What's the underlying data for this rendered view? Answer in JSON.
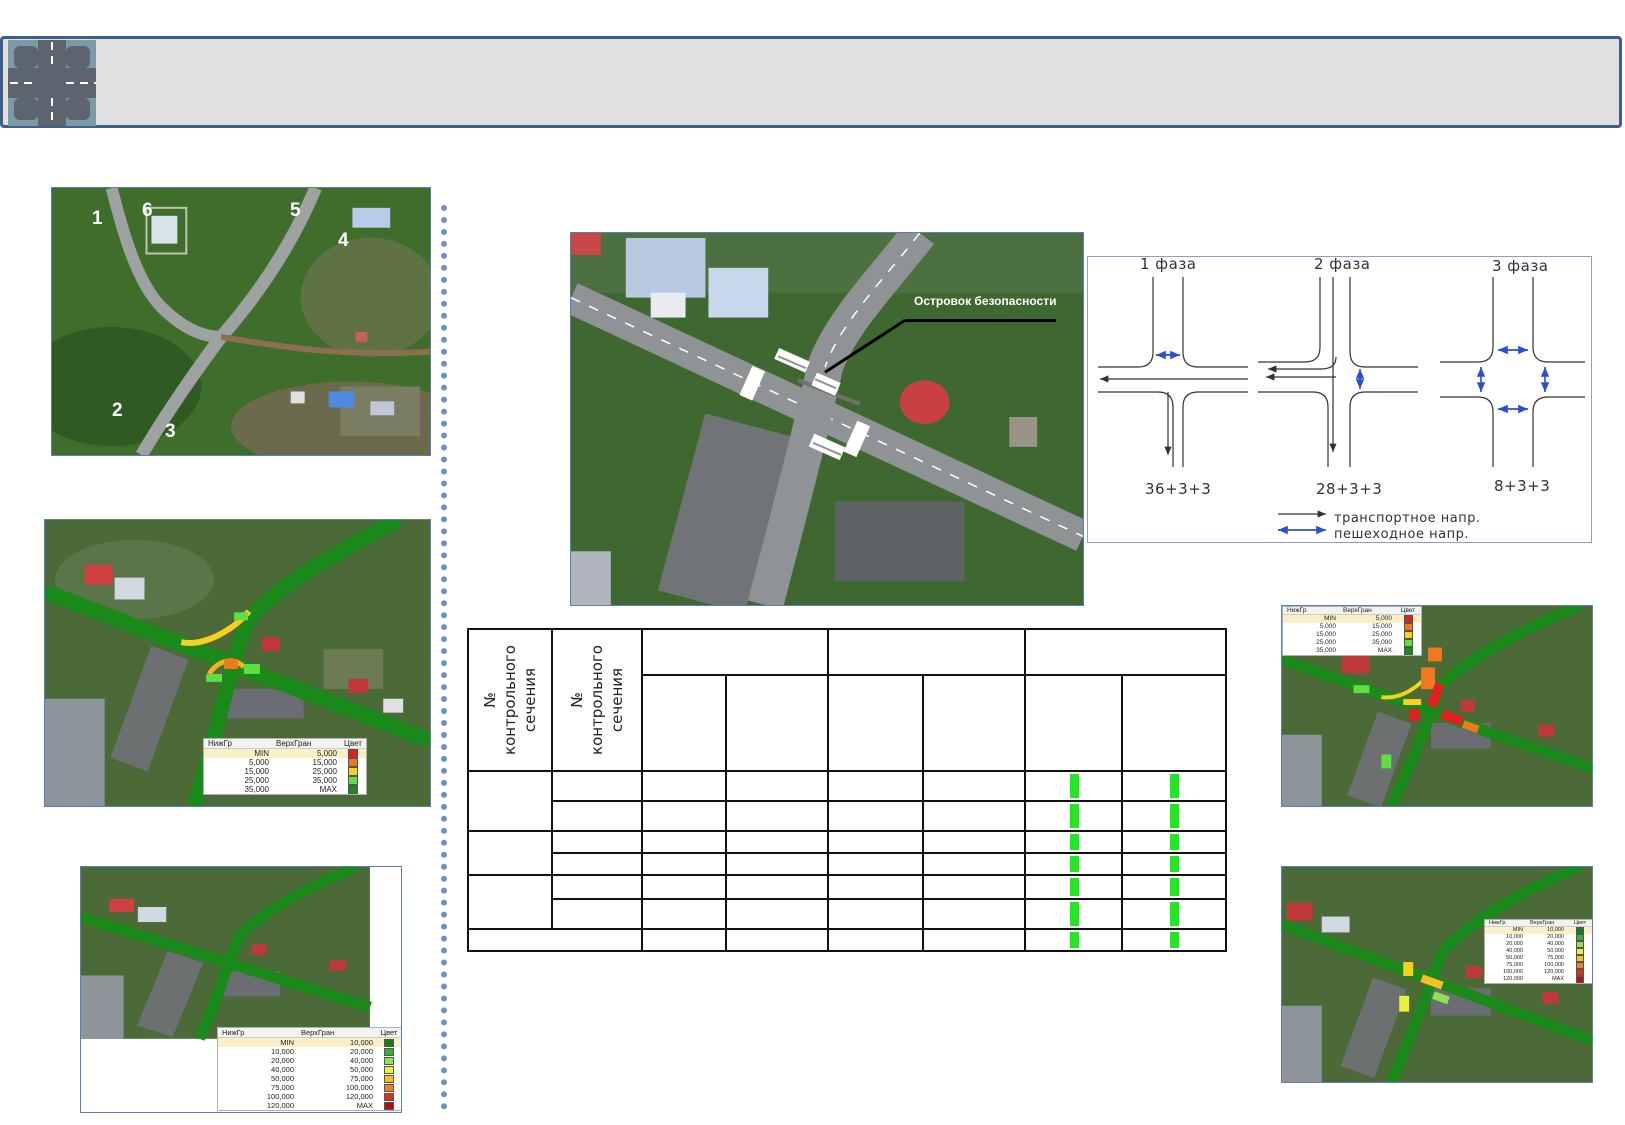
{
  "map_labels": [
    "1",
    "2",
    "3",
    "4",
    "5",
    "6"
  ],
  "callout": "Островок безопасности",
  "phase_diagram": {
    "phases": [
      "1 фаза",
      "2 фаза",
      "3 фаза"
    ],
    "timings": [
      "36+3+3",
      "28+3+3",
      "8+3+3"
    ],
    "legend": [
      "транспортное напр.",
      "пешеходное напр."
    ]
  },
  "table": {
    "header_col1": "№\nконтрольного\nсечения",
    "header_col2": "№\nконтрольного\nсечения"
  },
  "legends": {
    "left_mid": {
      "headers": [
        "НижГр",
        "ВерхГран",
        "Цвет"
      ],
      "rows": [
        {
          "lo": "MIN",
          "hi": "5,000",
          "color": "#e02020"
        },
        {
          "lo": "5,000",
          "hi": "15,000",
          "color": "#f07820"
        },
        {
          "lo": "15,000",
          "hi": "25,000",
          "color": "#f8d020"
        },
        {
          "lo": "25,000",
          "hi": "35,000",
          "color": "#60e040"
        },
        {
          "lo": "35,000",
          "hi": "MAX",
          "color": "#1a8a1a"
        }
      ]
    },
    "left_bottom": {
      "headers": [
        "НижГр",
        "ВерхГран",
        "Цвет"
      ],
      "rows": [
        {
          "lo": "MIN",
          "hi": "10,000",
          "color": "#1a7a1a"
        },
        {
          "lo": "10,000",
          "hi": "20,000",
          "color": "#38b030"
        },
        {
          "lo": "20,000",
          "hi": "40,000",
          "color": "#90e050"
        },
        {
          "lo": "40,000",
          "hi": "50,000",
          "color": "#e8f040"
        },
        {
          "lo": "50,000",
          "hi": "75,000",
          "color": "#f8c020"
        },
        {
          "lo": "75,000",
          "hi": "100,000",
          "color": "#f08020"
        },
        {
          "lo": "100,000",
          "hi": "120,000",
          "color": "#e03020"
        },
        {
          "lo": "120,000",
          "hi": "MAX",
          "color": "#b01010"
        }
      ]
    },
    "right_top": {
      "headers": [
        "НижГр",
        "ВерхГран",
        "Цвет"
      ],
      "rows": [
        {
          "lo": "MIN",
          "hi": "5,000",
          "color": "#e02020"
        },
        {
          "lo": "5,000",
          "hi": "15,000",
          "color": "#f07820"
        },
        {
          "lo": "15,000",
          "hi": "25,000",
          "color": "#f8d020"
        },
        {
          "lo": "25,000",
          "hi": "35,000",
          "color": "#60e040"
        },
        {
          "lo": "35,000",
          "hi": "MAX",
          "color": "#1a8a1a"
        }
      ]
    },
    "right_bottom": {
      "headers": [
        "НижГр",
        "ВерхГран",
        "Цвет"
      ],
      "rows": [
        {
          "lo": "MIN",
          "hi": "10,000",
          "color": "#1a7a1a"
        },
        {
          "lo": "10,000",
          "hi": "20,000",
          "color": "#38b030"
        },
        {
          "lo": "20,000",
          "hi": "40,000",
          "color": "#90e050"
        },
        {
          "lo": "40,000",
          "hi": "50,000",
          "color": "#e8f040"
        },
        {
          "lo": "50,000",
          "hi": "75,000",
          "color": "#f8c020"
        },
        {
          "lo": "75,000",
          "hi": "100,000",
          "color": "#f08020"
        },
        {
          "lo": "100,000",
          "hi": "120,000",
          "color": "#e03020"
        },
        {
          "lo": "120,000",
          "hi": "MAX",
          "color": "#b01010"
        }
      ]
    }
  }
}
